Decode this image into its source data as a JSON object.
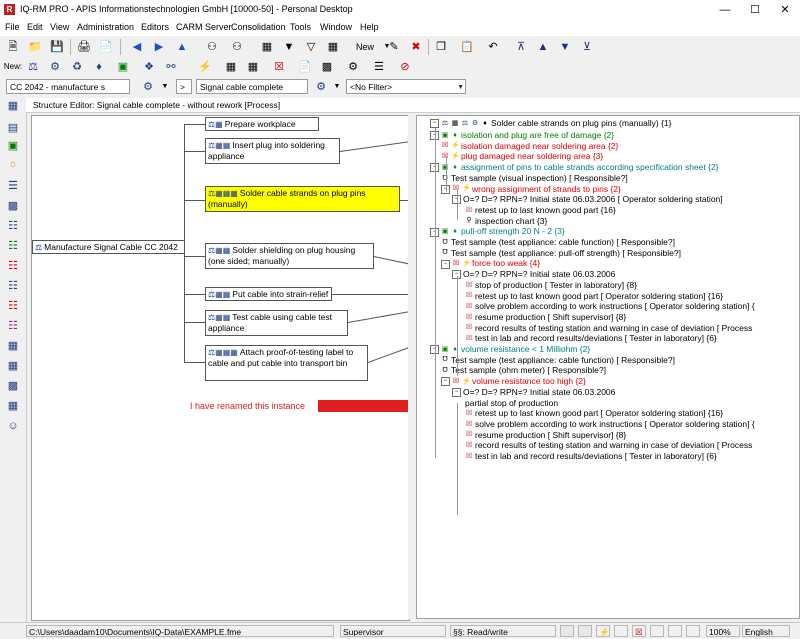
{
  "window": {
    "title": "IQ-RM PRO - APIS Informationstechnologien GmbH [10000-50] - Personal Desktop"
  },
  "menu": [
    "File",
    "Edit",
    "View",
    "Administration",
    "Editors",
    "CARM Server",
    "Consolidation",
    "Tools",
    "Window",
    "Help"
  ],
  "toolbar": {
    "new_label": "New",
    "new_row_label": "New:"
  },
  "combos": {
    "project": "CC 2042 - manufacture s",
    "gt": ">",
    "structure": "Signal cable complete",
    "filter": "<No Filter>"
  },
  "editor_header": "Structure Editor: Signal cable complete - without rework [Process]",
  "structure": {
    "root": "Manufacture Signal Cable CC 2042",
    "children": [
      "Prepare workplace",
      "Insert plug into soldering appliance",
      "Solder cable strands on plug pins (manually)",
      "Solder shielding on plug housing (one sided; manually)",
      "Put cable into strain-relief",
      "Test cable using cable test appliance",
      "Attach proof-of-testing label to cable and put cable into transport bin"
    ]
  },
  "tree": {
    "root": "Solder cable strands on plug pins (manually) {1}",
    "rows": [
      {
        "t": "isolation and plug are free of damage {2}",
        "c": "green",
        "lvl": 1,
        "k": "fn"
      },
      {
        "t": "isolation damaged near soldering area {2}",
        "c": "red",
        "lvl": 2,
        "k": "fail"
      },
      {
        "t": "plug damaged near soldering area {3}",
        "c": "red",
        "lvl": 2,
        "k": "fail"
      },
      {
        "t": "assignment of pins to cable strands according specification sheet   {2}",
        "c": "teal",
        "lvl": 1,
        "k": "fn"
      },
      {
        "t": "Test sample (visual inspection) [  Responsible?]",
        "c": "",
        "lvl": 2,
        "k": "ctl"
      },
      {
        "t": "wrong assignment of strands to pins {2}",
        "c": "red",
        "lvl": 2,
        "k": "fail"
      },
      {
        "t": "O=? D=? RPN=?  Initial state 06.03.2006 [  Operator soldering station]",
        "c": "",
        "lvl": 3,
        "k": "rpn"
      },
      {
        "t": "retest up to last known good part {16}",
        "c": "",
        "lvl": 4,
        "k": "act"
      },
      {
        "t": "inspection chart {3}",
        "c": "",
        "lvl": 4,
        "k": "act2"
      },
      {
        "t": "pull-off strength 20 N - 2 {3}",
        "c": "teal",
        "lvl": 1,
        "k": "fn"
      },
      {
        "t": "Test sample (test appliance: cable function) [  Responsible?]",
        "c": "",
        "lvl": 2,
        "k": "ctl"
      },
      {
        "t": "Test sample (test appliance: pull-off strength) [  Responsible?]",
        "c": "",
        "lvl": 2,
        "k": "ctl"
      },
      {
        "t": "force too weak {4}",
        "c": "red",
        "lvl": 2,
        "k": "fail"
      },
      {
        "t": "O=? D=? RPN=?  Initial state 06.03.2006",
        "c": "",
        "lvl": 3,
        "k": "rpn"
      },
      {
        "t": "stop of production [  Tester in laboratory] {8}",
        "c": "",
        "lvl": 4,
        "k": "act"
      },
      {
        "t": "retest up to last known good part [  Operator soldering station] {16}",
        "c": "",
        "lvl": 4,
        "k": "act"
      },
      {
        "t": "solve problem according to work instructions [  Operator soldering station] {",
        "c": "",
        "lvl": 4,
        "k": "act"
      },
      {
        "t": "resume production [  Shift supervisor] {8}",
        "c": "",
        "lvl": 4,
        "k": "act"
      },
      {
        "t": "record results of testing station and warning in case of deviation [  Process",
        "c": "",
        "lvl": 4,
        "k": "act"
      },
      {
        "t": "test in lab and record results/deviations [  Tester in laboratory] {6}",
        "c": "",
        "lvl": 4,
        "k": "act"
      },
      {
        "t": "volume resistance < 1 Milliohm  {2}",
        "c": "teal",
        "lvl": 1,
        "k": "fn"
      },
      {
        "t": "Test sample (test appliance: cable function) [  Responsible?]",
        "c": "",
        "lvl": 2,
        "k": "ctl"
      },
      {
        "t": "Test sample (ohm meter) [  Responsible?]",
        "c": "",
        "lvl": 2,
        "k": "ctl"
      },
      {
        "t": "volume resistance too high {2}",
        "c": "red",
        "lvl": 2,
        "k": "fail"
      },
      {
        "t": "O=? D=? RPN=?  Initial state 06.03.2006",
        "c": "",
        "lvl": 3,
        "k": "rpn"
      },
      {
        "t": "partial stop of production",
        "c": "",
        "lvl": 4,
        "k": "plain"
      },
      {
        "t": "retest up to last known good part [  Operator soldering station] {16}",
        "c": "",
        "lvl": 4,
        "k": "act"
      },
      {
        "t": "solve problem according to work instructions [  Operator soldering station] {",
        "c": "",
        "lvl": 4,
        "k": "act"
      },
      {
        "t": "resume production [  Shift supervisor] {8}",
        "c": "",
        "lvl": 4,
        "k": "act"
      },
      {
        "t": "record results of testing station and warning in case of deviation [  Process",
        "c": "",
        "lvl": 4,
        "k": "act"
      },
      {
        "t": "test in lab and record results/deviations [  Tester in laboratory] {6}",
        "c": "",
        "lvl": 4,
        "k": "act"
      }
    ]
  },
  "annotation": "I have renamed this instance",
  "status": {
    "path": "C:\\Users\\daadam10\\Documents\\IQ-Data\\EXAMPLE.fme",
    "user": "Supervisor",
    "mode": "§§: Read/write",
    "zoom": "100%",
    "language": "English"
  },
  "colors": {
    "selected": "#ffff00",
    "arrow": "#e02020",
    "fail": "#e00000",
    "function": "#008000",
    "teal": "#008080"
  }
}
